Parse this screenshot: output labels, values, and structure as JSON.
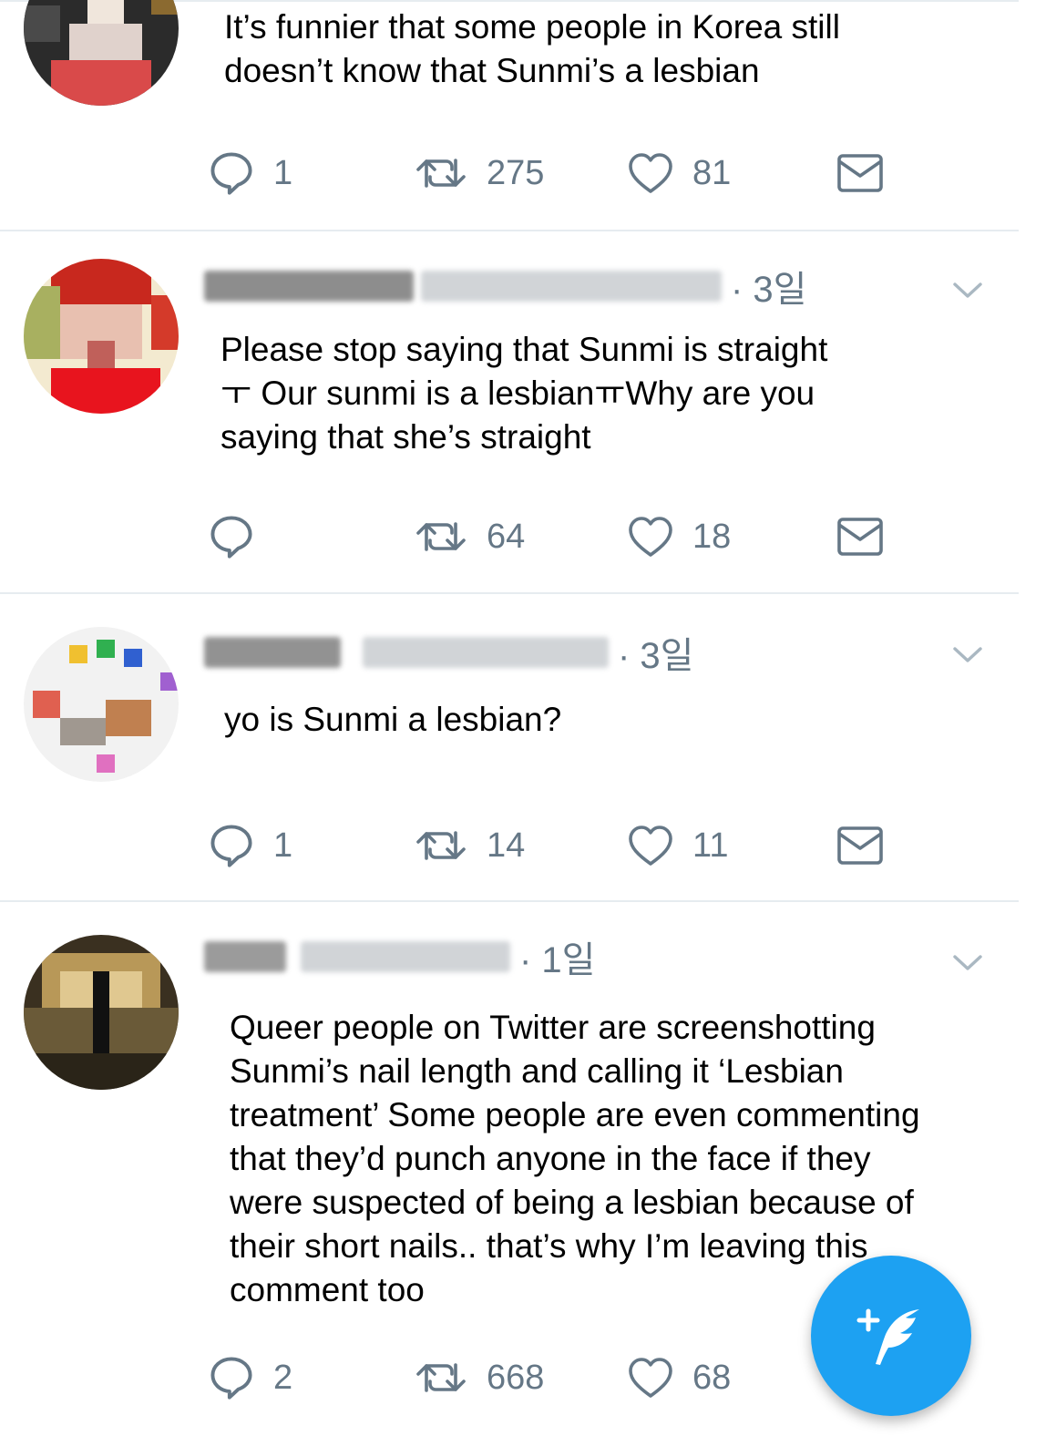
{
  "colors": {
    "accent": "#1da1f2",
    "icon_gray": "#657786",
    "text": "#000000",
    "divider": "#e6ecf0"
  },
  "icons": {
    "reply": "reply-icon",
    "retweet": "retweet-icon",
    "like": "heart-icon",
    "dm": "envelope-icon",
    "more": "chevron-down-icon",
    "compose": "compose-tweet-icon"
  },
  "tweets": [
    {
      "text": "It’s funnier that some people in Korea still\ndoesn’t know that Sunmi’s a lesbian",
      "replies": "1",
      "retweets": "275",
      "likes": "81"
    },
    {
      "time": "· 3일",
      "text": "Please stop saying that Sunmi is straight\nㅜ Our sunmi is a lesbianㅠWhy are you\nsaying that she’s straight",
      "replies": "",
      "retweets": "64",
      "likes": "18"
    },
    {
      "time": "· 3일",
      "text": "yo is Sunmi a lesbian?",
      "replies": "1",
      "retweets": "14",
      "likes": "11"
    },
    {
      "time": "· 1일",
      "text": "Queer people on Twitter are screenshotting\nSunmi’s nail length and calling it ‘Lesbian\ntreatment’ Some people are even commenting\nthat they’d punch anyone in the face if they\nwere suspected of being a lesbian because of\ntheir short nails.. that’s why I’m leaving this\ncomment too",
      "replies": "2",
      "retweets": "668",
      "likes": "68"
    }
  ]
}
